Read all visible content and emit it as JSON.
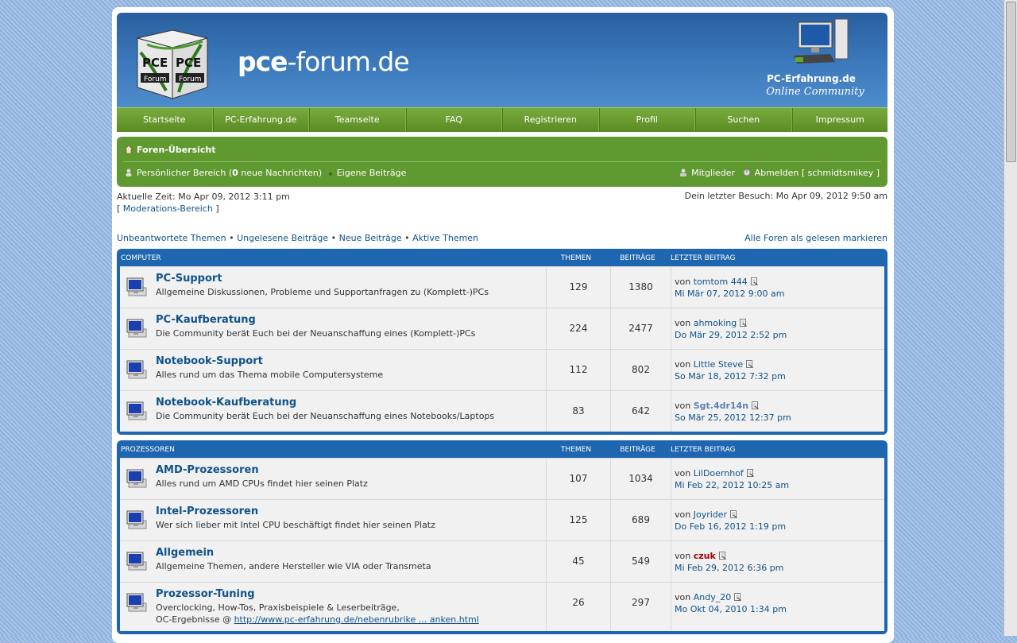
{
  "header": {
    "site_title_a": "pce",
    "site_title_b": "-forum.de",
    "logo_text_1": "PCE",
    "logo_text_2": "PCE",
    "logo_text_3": "Forum",
    "logo_text_4": "Forum",
    "brand_name": "PC-Erfahrung.de",
    "brand_tagline": "Online Community"
  },
  "nav": [
    "Startseite",
    "PC-Erfahrung.de",
    "Teamseite",
    "FAQ",
    "Registrieren",
    "Profil",
    "Suchen",
    "Impressum"
  ],
  "navbar": {
    "crumb": "Foren-Übersicht",
    "personal": "Persönlicher Bereich",
    "paren_open": "(",
    "new_count": "0",
    "new_messages": "neue Nachrichten",
    "paren_close": ")",
    "own_posts": "Eigene Beiträge",
    "members": "Mitglieder",
    "logout": "Abmelden [ schmidtsmikey ]"
  },
  "info": {
    "current_time": "Aktuelle Zeit: Mo Apr 09, 2012 3:11 pm",
    "bracket_open": "[",
    "mod_area": "Moderations-Bereich",
    "bracket_close": "]",
    "last_visit": "Dein letzter Besuch: Mo Apr 09, 2012 9:50 am"
  },
  "quicklinks": {
    "unanswered": "Unbeantwortete Themen",
    "unread": "Ungelesene Beiträge",
    "new_posts": "Neue Beiträge",
    "active": "Aktive Themen",
    "sep": "•",
    "mark_read": "Alle Foren als gelesen markieren"
  },
  "columns": {
    "topics": "Themen",
    "posts": "Beiträge",
    "last": "Letzter Beitrag"
  },
  "by": "von",
  "categories": [
    {
      "name": "Computer",
      "forums": [
        {
          "title": "PC-Support",
          "desc": "Allgemeine Diskussionen, Probleme und Supportanfragen zu (Komplett-)PCs",
          "topics": "129",
          "posts": "1380",
          "user": "tomtom 444",
          "date": "Mi Mär 07, 2012 9:00 am"
        },
        {
          "title": "PC-Kaufberatung",
          "desc": "Die Community berät Euch bei der Neuanschaffung eines (Komplett-)PCs",
          "topics": "224",
          "posts": "2477",
          "user": "ahmoking",
          "date": "Do Mär 29, 2012 2:52 pm"
        },
        {
          "title": "Notebook-Support",
          "desc": "Alles rund um das Thema mobile Computersysteme",
          "topics": "112",
          "posts": "802",
          "user": "Little Steve",
          "date": "So Mär 18, 2012 7:32 pm"
        },
        {
          "title": "Notebook-Kaufberatung",
          "desc": "Die Community berät Euch bei der Neuanschaffung eines Notebooks/Laptops",
          "topics": "83",
          "posts": "642",
          "user": "Sgt.4dr14n",
          "date": "So Mär 25, 2012 12:37 pm"
        }
      ]
    },
    {
      "name": "Prozessoren",
      "forums": [
        {
          "title": "AMD-Prozessoren",
          "desc": "Alles rund um AMD CPUs findet hier seinen Platz",
          "topics": "107",
          "posts": "1034",
          "user": "LilDoernhof",
          "date": "Mi Feb 22, 2012 10:25 am"
        },
        {
          "title": "Intel-Prozessoren",
          "desc": "Wer sich lieber mit Intel CPU beschäftigt findet hier seinen Platz",
          "topics": "125",
          "posts": "689",
          "user": "Joyrider",
          "date": "Do Feb 16, 2012 1:19 pm"
        },
        {
          "title": "Allgemein",
          "desc": "Allgemeine Themen, andere Hersteller wie VIA oder Transmeta",
          "topics": "45",
          "posts": "549",
          "user": "czuk",
          "date": "Mi Feb 29, 2012 6:36 pm"
        },
        {
          "title": "Prozessor-Tuning",
          "desc": "Overclocking, How-Tos, Praxisbeispiele & Leserbeiträge,",
          "desc2": "OC-Ergebnisse @",
          "desc_link": "http://www.pc-erfahrung.de/nebenrubrike ... anken.html",
          "topics": "26",
          "posts": "297",
          "user": "Andy_20",
          "date": "Mo Okt 04, 2010 1:34 pm"
        }
      ]
    }
  ],
  "colors": {
    "nav_green": "#5b8b24",
    "bar_green": "#5f9930",
    "block_blue": "#1f66b0",
    "link_blue": "#105289",
    "user_red": "#aa0000"
  }
}
